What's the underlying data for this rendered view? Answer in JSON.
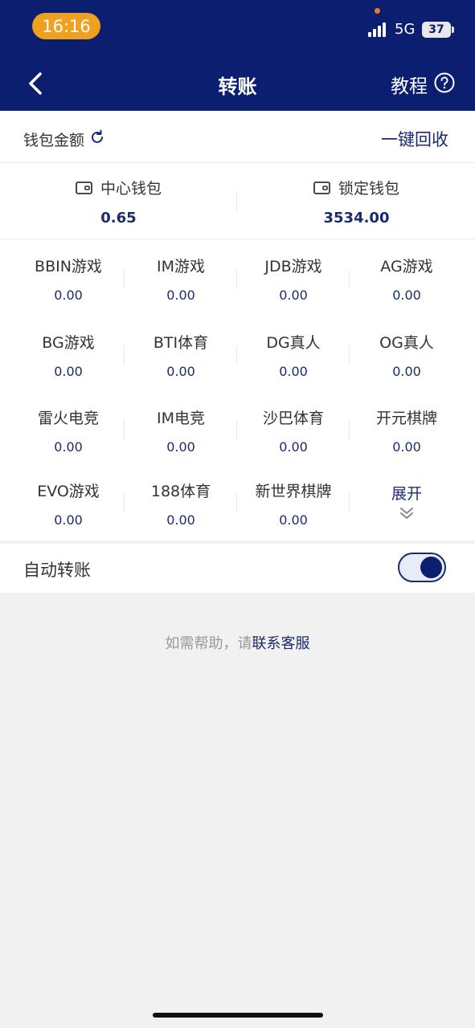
{
  "status_bar": {
    "time": "16:16",
    "network": "5G",
    "battery": "37"
  },
  "nav": {
    "title": "转账",
    "tutorial": "教程"
  },
  "wallet_header": {
    "label": "钱包金额",
    "recall": "一键回收"
  },
  "wallets": [
    {
      "name": "中心钱包",
      "value": "0.65"
    },
    {
      "name": "锁定钱包",
      "value": "3534.00"
    }
  ],
  "games": [
    {
      "name": "BBIN游戏",
      "value": "0.00"
    },
    {
      "name": "IM游戏",
      "value": "0.00"
    },
    {
      "name": "JDB游戏",
      "value": "0.00"
    },
    {
      "name": "AG游戏",
      "value": "0.00"
    },
    {
      "name": "BG游戏",
      "value": "0.00"
    },
    {
      "name": "BTI体育",
      "value": "0.00"
    },
    {
      "name": "DG真人",
      "value": "0.00"
    },
    {
      "name": "OG真人",
      "value": "0.00"
    },
    {
      "name": "雷火电竞",
      "value": "0.00"
    },
    {
      "name": "IM电竞",
      "value": "0.00"
    },
    {
      "name": "沙巴体育",
      "value": "0.00"
    },
    {
      "name": "开元棋牌",
      "value": "0.00"
    },
    {
      "name": "EVO游戏",
      "value": "0.00"
    },
    {
      "name": "188体育",
      "value": "0.00"
    },
    {
      "name": "新世界棋牌",
      "value": "0.00"
    }
  ],
  "expand_label": "展开",
  "auto_transfer": {
    "label": "自动转账",
    "enabled": true
  },
  "help": {
    "prefix": "如需帮助，请",
    "link": "联系客服"
  },
  "colors": {
    "header_bg": "#0b1e6f",
    "accent": "#1c2b6e",
    "time_pill": "#f0a020"
  }
}
